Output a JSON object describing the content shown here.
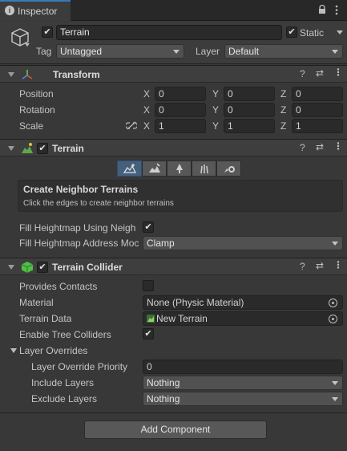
{
  "tab": {
    "title": "Inspector"
  },
  "object": {
    "name": "Terrain",
    "static_label": "Static",
    "tag_label": "Tag",
    "tag_value": "Untagged",
    "layer_label": "Layer",
    "layer_value": "Default"
  },
  "transform": {
    "title": "Transform",
    "position_label": "Position",
    "rotation_label": "Rotation",
    "scale_label": "Scale",
    "axis_x": "X",
    "axis_y": "Y",
    "axis_z": "Z",
    "position": {
      "x": "0",
      "y": "0",
      "z": "0"
    },
    "rotation": {
      "x": "0",
      "y": "0",
      "z": "0"
    },
    "scale": {
      "x": "1",
      "y": "1",
      "z": "1"
    }
  },
  "terrain": {
    "title": "Terrain",
    "tools": [
      "create-neighbor",
      "paint-terrain",
      "paint-trees",
      "paint-details",
      "terrain-settings"
    ],
    "tool_heading": "Create Neighbor Terrains",
    "tool_desc": "Click the edges to create neighbor terrains",
    "fill_heightmap_label": "Fill Heightmap Using Neigh",
    "fill_heightmap_address_label": "Fill Heightmap Address Moc",
    "fill_heightmap_address_value": "Clamp"
  },
  "collider": {
    "title": "Terrain Collider",
    "provides_contacts_label": "Provides Contacts",
    "material_label": "Material",
    "material_value": "None (Physic Material)",
    "terrain_data_label": "Terrain Data",
    "terrain_data_value": "New Terrain",
    "enable_tree_label": "Enable Tree Colliders",
    "layer_overrides_label": "Layer Overrides",
    "priority_label": "Layer Override Priority",
    "priority_value": "0",
    "include_label": "Include Layers",
    "include_value": "Nothing",
    "exclude_label": "Exclude Layers",
    "exclude_value": "Nothing"
  },
  "add_component_label": "Add Component",
  "checkmark": "✔",
  "colors": {
    "tab_accent": "#3a79bb",
    "background": "#383838",
    "header": "#3e3e3e"
  }
}
